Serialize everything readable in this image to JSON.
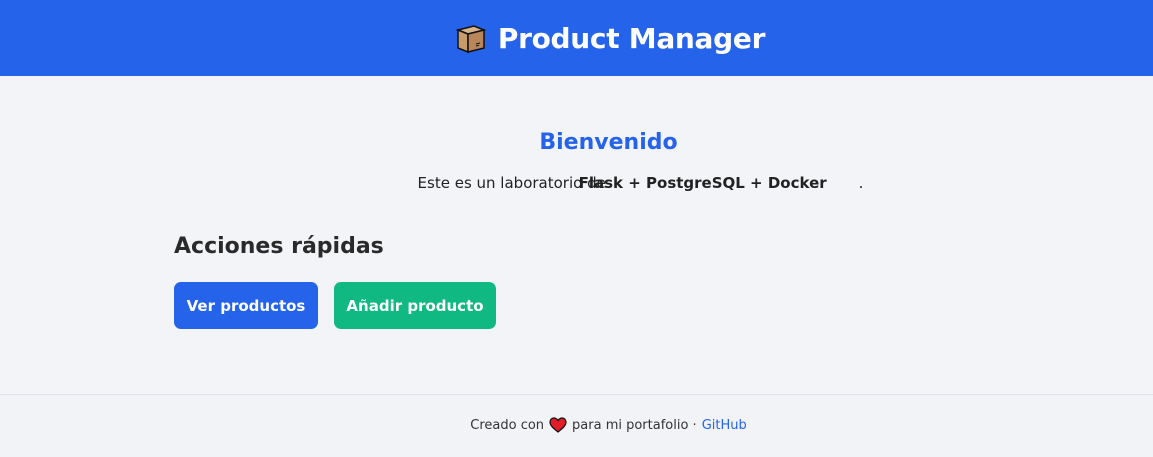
{
  "header": {
    "title": "Product Manager",
    "icon": "package-box-icon",
    "background": "#2563eb"
  },
  "welcome": {
    "title": "Bienvenido",
    "text_prefix": "Este es un laboratorio de ",
    "text_bold": "Flask + PostgreSQL + Docker",
    "text_suffix": "."
  },
  "quick_actions": {
    "title": "Acciones rápidas",
    "buttons": [
      {
        "label": "Ver productos",
        "color": "#2563eb"
      },
      {
        "label": "Añadir producto",
        "color": "#10b981"
      }
    ]
  },
  "footer": {
    "prefix": "Creado con",
    "icon": "heart-icon",
    "middle": "para mi portafolio ·",
    "link_label": "GitHub"
  }
}
